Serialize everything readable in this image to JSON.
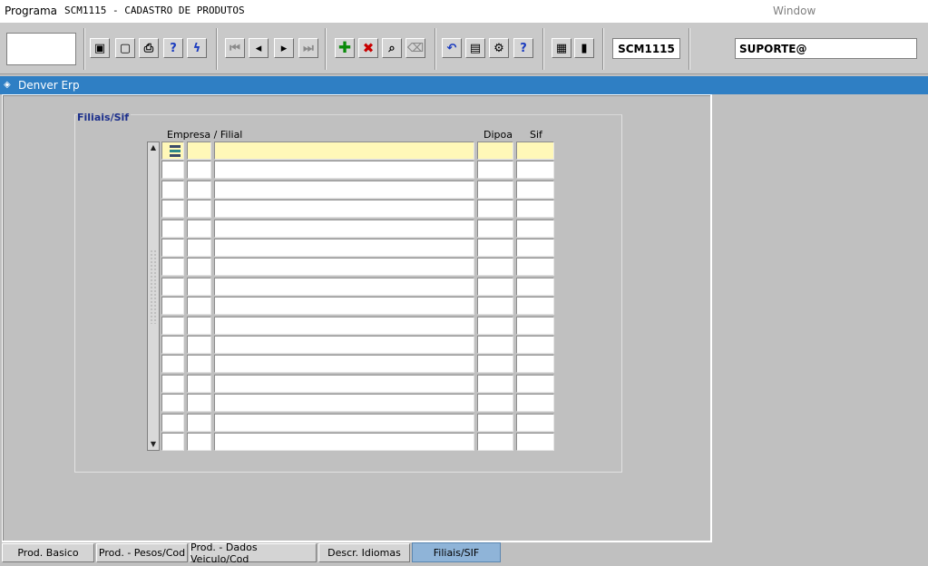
{
  "menubar": {
    "programa": "Programa",
    "title": "SCM1115 - CADASTRO DE PRODUTOS",
    "window": "Window"
  },
  "toolbar": {
    "buttons": [
      {
        "name": "save-button",
        "icon": "floppy-disk-icon",
        "glyph": "▣"
      },
      {
        "name": "screen-button",
        "icon": "monitor-icon",
        "glyph": "▢"
      },
      {
        "name": "print-button",
        "icon": "printer-icon",
        "glyph": "⎙"
      },
      {
        "name": "help-query-button",
        "icon": "query-help-icon",
        "glyph": "?"
      },
      {
        "name": "execute-query-button",
        "icon": "lightning-icon",
        "glyph": "ϟ"
      },
      {
        "name": "first-record-button",
        "icon": "first-icon",
        "glyph": "⏮"
      },
      {
        "name": "previous-record-button",
        "icon": "previous-icon",
        "glyph": "◂"
      },
      {
        "name": "next-record-button",
        "icon": "next-icon",
        "glyph": "▸"
      },
      {
        "name": "last-record-button",
        "icon": "last-icon",
        "glyph": "⏭"
      },
      {
        "name": "insert-record-button",
        "icon": "plus-icon",
        "glyph": "✚"
      },
      {
        "name": "delete-record-button",
        "icon": "x-icon",
        "glyph": "✖"
      },
      {
        "name": "search-record-button",
        "icon": "search-icon",
        "glyph": "⌕"
      },
      {
        "name": "clear-button",
        "icon": "eraser-icon",
        "glyph": "⌫"
      },
      {
        "name": "undo-button",
        "icon": "undo-icon",
        "glyph": "↶"
      },
      {
        "name": "clipboard-button",
        "icon": "clipboard-icon",
        "glyph": "▤"
      },
      {
        "name": "tools-button",
        "icon": "tools-icon",
        "glyph": "⚙"
      },
      {
        "name": "help-button",
        "icon": "help-icon",
        "glyph": "?"
      },
      {
        "name": "menu-button",
        "icon": "menu-icon",
        "glyph": "▦"
      },
      {
        "name": "exit-button",
        "icon": "exit-door-icon",
        "glyph": "▮"
      }
    ],
    "program_code": "SCM1115",
    "user": "SUPORTE@"
  },
  "window": {
    "title": "Denver Erp"
  },
  "form": {
    "frame_title": "Filiais/Sif",
    "columns": {
      "empresa_filial": "Empresa / Filial",
      "dipoa": "Dipoa",
      "sif": "Sif"
    },
    "row_count": 16,
    "current_row": 0
  },
  "tabs": [
    {
      "label": "Prod. Basico",
      "active": false
    },
    {
      "label": "Prod. - Pesos/Cod",
      "active": false
    },
    {
      "label": "Prod. - Dados Veiculo/Cod",
      "active": false
    },
    {
      "label": "Descr. Idiomas",
      "active": false
    },
    {
      "label": "Filiais/SIF",
      "active": true
    }
  ]
}
